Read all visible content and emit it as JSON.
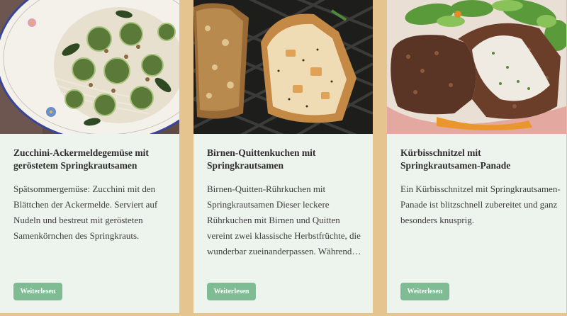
{
  "cards": [
    {
      "title": "Zucchini-Ackermeldegemüse mit geröstetem Springkrautsamen",
      "excerpt": "Spätsommergemüse: Zucchini mit den Blättchen der Ackermelde. Serviert auf Nudeln und bestreut mit gerösteten Samenkörnchen des Springkrauts.",
      "button_label": "Weiterlesen"
    },
    {
      "title": "Birnen-Quittenkuchen mit Springkrautsamen",
      "excerpt": "Birnen-Quitten-Rührkuchen mit Springkrautsamen Dieser leckere Rührkuchen mit Birnen und Quitten vereint zwei klassische Herbstfrüchte, die wunderbar zueinanderpassen. Während…",
      "button_label": "Weiterlesen"
    },
    {
      "title": "Kürbisschnitzel mit Springkrautsamen-Panade",
      "excerpt": "Ein Kürbisschnitzel mit Springkrautsamen-Panade ist blitzschnell zubereitet und ganz besonders knusprig.",
      "button_label": "Weiterlesen"
    }
  ],
  "colors": {
    "page_background": "#e6c48f",
    "card_background": "#edf4ee",
    "button_background": "#7fbc93",
    "title_text": "#2e2e2e"
  }
}
